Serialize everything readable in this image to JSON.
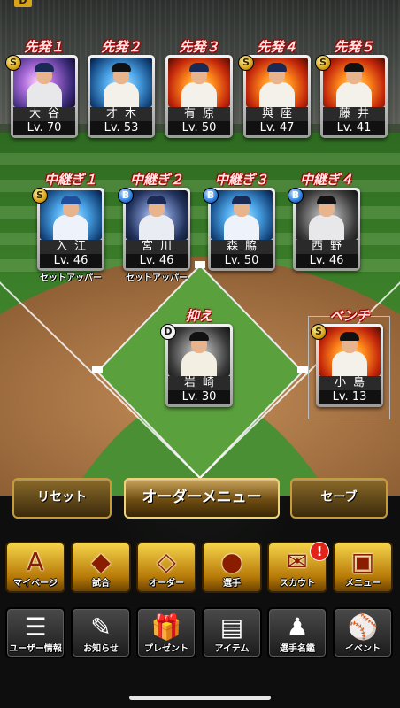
{
  "corner_badge": "D",
  "starters": [
    {
      "role": "先発１",
      "name": "大谷",
      "lv": "Lv. 70",
      "rank": "S",
      "photo": "purple",
      "uniform": "#e8e8ea",
      "cap": "#1b2a55"
    },
    {
      "role": "先発２",
      "name": "才木",
      "lv": "Lv. 53",
      "rank": "",
      "photo": "blue",
      "uniform": "#f4f1ea",
      "cap": "#111"
    },
    {
      "role": "先発３",
      "name": "有原",
      "lv": "Lv. 50",
      "rank": "",
      "photo": "fire",
      "uniform": "#f4f1ea",
      "cap": "#1b2a55"
    },
    {
      "role": "先発４",
      "name": "與座",
      "lv": "Lv. 47",
      "rank": "S",
      "photo": "fire",
      "uniform": "#f4f1ea",
      "cap": "#1b2a55"
    },
    {
      "role": "先発５",
      "name": "藤井",
      "lv": "Lv. 41",
      "rank": "S",
      "photo": "fire",
      "uniform": "#f4f1ea",
      "cap": "#111"
    }
  ],
  "relievers": [
    {
      "role": "中継ぎ１",
      "name": "入江",
      "lv": "Lv. 46",
      "rank": "S",
      "photo": "blue",
      "uniform": "#eef3fb",
      "cap": "#1f4e9c",
      "note": "セットアッパー"
    },
    {
      "role": "中継ぎ２",
      "name": "宮川",
      "lv": "Lv. 46",
      "rank": "B",
      "photo": "swirl",
      "uniform": "#e9ecf2",
      "cap": "#1b2a55",
      "note": "セットアッパー"
    },
    {
      "role": "中継ぎ３",
      "name": "森脇",
      "lv": "Lv. 50",
      "rank": "B",
      "photo": "blue",
      "uniform": "#eef3fb",
      "cap": "#1b2a55",
      "note": ""
    },
    {
      "role": "中継ぎ４",
      "name": "西野",
      "lv": "Lv. 46",
      "rank": "B",
      "photo": "dark",
      "uniform": "#e8e8ea",
      "cap": "#111",
      "note": ""
    }
  ],
  "closer": {
    "role": "抑え",
    "name": "岩崎",
    "lv": "Lv. 30",
    "rank": "D",
    "photo": "dark",
    "uniform": "#f3efe2",
    "cap": "#111"
  },
  "bench": {
    "role": "ベンチ",
    "name": "小島",
    "lv": "Lv. 13",
    "rank": "S",
    "photo": "fire",
    "uniform": "#f4f1ea",
    "cap": "#111"
  },
  "controls": {
    "reset": "リセット",
    "order_menu": "オーダーメニュー",
    "save": "セーブ"
  },
  "nav_primary": [
    {
      "label": "マイページ",
      "icon": "A"
    },
    {
      "label": "試合",
      "icon": "◆"
    },
    {
      "label": "オーダー",
      "icon": "◇"
    },
    {
      "label": "選手",
      "icon": "●"
    },
    {
      "label": "スカウト",
      "icon": "✉"
    },
    {
      "label": "メニュー",
      "icon": "▣"
    }
  ],
  "nav_secondary": [
    {
      "label": "ユーザー情報",
      "icon": "☰"
    },
    {
      "label": "お知らせ",
      "icon": "✎"
    },
    {
      "label": "プレゼント",
      "icon": "🎁"
    },
    {
      "label": "アイテム",
      "icon": "▤"
    },
    {
      "label": "選手名鑑",
      "icon": "♟"
    },
    {
      "label": "イベント",
      "icon": "⚾"
    }
  ],
  "scout_alert": "!",
  "colors": {
    "role_label": "#c00000",
    "gold": "#d8a41b",
    "field_grass": "#3f8a2c",
    "dirt": "#b07a48"
  }
}
